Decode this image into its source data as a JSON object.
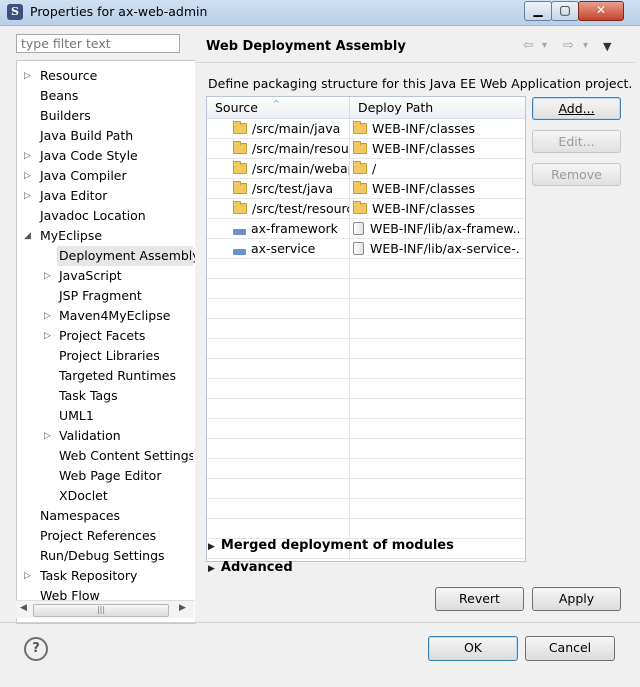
{
  "window": {
    "title": "Properties for ax-web-admin",
    "app_icon_glyph": "S",
    "controls": {
      "min_glyph": "▁",
      "max_glyph": "▢",
      "close_glyph": "✕"
    }
  },
  "nav": {
    "filter_placeholder": "type filter text",
    "items": [
      {
        "label": "Resource",
        "expander": "▷"
      },
      {
        "label": "Beans",
        "expander": ""
      },
      {
        "label": "Builders",
        "expander": ""
      },
      {
        "label": "Java Build Path",
        "expander": ""
      },
      {
        "label": "Java Code Style",
        "expander": "▷"
      },
      {
        "label": "Java Compiler",
        "expander": "▷"
      },
      {
        "label": "Java Editor",
        "expander": "▷"
      },
      {
        "label": "Javadoc Location",
        "expander": ""
      },
      {
        "label": "MyEclipse",
        "expander": "◢"
      },
      {
        "label": "Deployment Assembly",
        "expander": ""
      },
      {
        "label": "JavaScript",
        "expander": "▷"
      },
      {
        "label": "JSP Fragment",
        "expander": ""
      },
      {
        "label": "Maven4MyEclipse",
        "expander": "▷"
      },
      {
        "label": "Project Facets",
        "expander": "▷"
      },
      {
        "label": "Project Libraries",
        "expander": ""
      },
      {
        "label": "Targeted Runtimes",
        "expander": ""
      },
      {
        "label": "Task Tags",
        "expander": ""
      },
      {
        "label": "UML1",
        "expander": ""
      },
      {
        "label": "Validation",
        "expander": "▷"
      },
      {
        "label": "Web Content Settings",
        "expander": ""
      },
      {
        "label": "Web Page Editor",
        "expander": ""
      },
      {
        "label": "XDoclet",
        "expander": ""
      },
      {
        "label": "Namespaces",
        "expander": ""
      },
      {
        "label": "Project References",
        "expander": ""
      },
      {
        "label": "Run/Debug Settings",
        "expander": ""
      },
      {
        "label": "Task Repository",
        "expander": "▷"
      },
      {
        "label": "Web Flow",
        "expander": ""
      }
    ],
    "scroll": {
      "left_arrow": "◀",
      "right_arrow": "▶",
      "thumb_grip": "|||"
    }
  },
  "page": {
    "title": "Web Deployment Assembly",
    "nav_arrows": {
      "back": "⇦",
      "back_menu": "▾",
      "forward": "⇨",
      "forward_menu": "▾",
      "view_menu": "▼"
    },
    "description": "Define packaging structure for this Java EE Web Application project.",
    "table": {
      "headers": {
        "source": "Source",
        "deploy_path": "Deploy Path"
      },
      "sort_caret": "^",
      "rows": [
        {
          "source": "/src/main/java",
          "deploy": "WEB-INF/classes",
          "src_icon": "folder",
          "dst_icon": "folder"
        },
        {
          "source": "/src/main/resources",
          "deploy": "WEB-INF/classes",
          "src_icon": "folder",
          "dst_icon": "folder"
        },
        {
          "source": "/src/main/webapp",
          "deploy": "/",
          "src_icon": "folder",
          "dst_icon": "folder"
        },
        {
          "source": "/src/test/java",
          "deploy": "WEB-INF/classes",
          "src_icon": "folder",
          "dst_icon": "folder"
        },
        {
          "source": "/src/test/resources",
          "deploy": "WEB-INF/classes",
          "src_icon": "folder",
          "dst_icon": "folder"
        },
        {
          "source": "ax-framework",
          "deploy": "WEB-INF/lib/ax-framew...",
          "src_icon": "project",
          "dst_icon": "library"
        },
        {
          "source": "ax-service",
          "deploy": "WEB-INF/lib/ax-service-...",
          "src_icon": "project",
          "dst_icon": "library"
        }
      ]
    },
    "buttons": {
      "add": "Add...",
      "edit": "Edit...",
      "remove": "Remove"
    },
    "sections": {
      "expander": "▶",
      "merged": "Merged deployment of modules",
      "advanced": "Advanced"
    },
    "revert": "Revert",
    "apply": "Apply"
  },
  "footer": {
    "help_glyph": "?",
    "ok": "OK",
    "cancel": "Cancel"
  }
}
